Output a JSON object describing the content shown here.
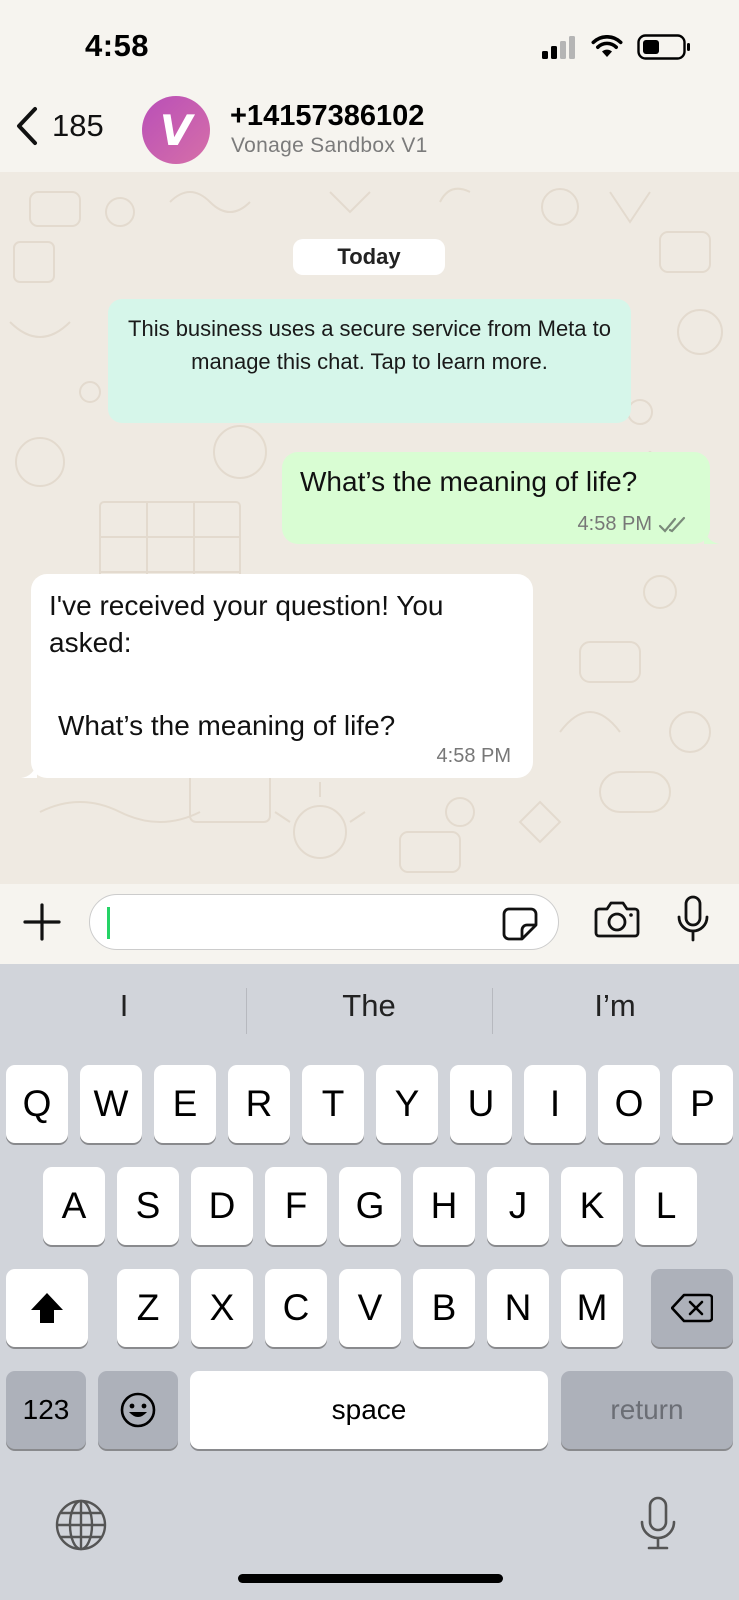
{
  "status_bar": {
    "time": "4:58"
  },
  "header": {
    "back_count": "185",
    "avatar_letter": "V",
    "contact_name": "+14157386102",
    "contact_subtitle": "Vonage Sandbox V1"
  },
  "chat": {
    "date_chip": "Today",
    "system_note": "This business uses a secure service from Meta to manage this chat. Tap to learn more.",
    "messages": [
      {
        "direction": "outgoing",
        "text": "What’s the meaning of life?",
        "time": "4:58 PM",
        "status": "read"
      },
      {
        "direction": "incoming",
        "text": "I've received your question! You asked:",
        "quote": "What’s the meaning of life?",
        "time": "4:58 PM"
      }
    ]
  },
  "composer": {
    "value": ""
  },
  "keyboard": {
    "suggestions": [
      "I",
      "The",
      "I’m"
    ],
    "row1": [
      "Q",
      "W",
      "E",
      "R",
      "T",
      "Y",
      "U",
      "I",
      "O",
      "P"
    ],
    "row2": [
      "A",
      "S",
      "D",
      "F",
      "G",
      "H",
      "J",
      "K",
      "L"
    ],
    "row3": [
      "Z",
      "X",
      "C",
      "V",
      "B",
      "N",
      "M"
    ],
    "numbers_label": "123",
    "space_label": "space",
    "return_label": "return"
  },
  "colors": {
    "outgoing_bubble": "#d9fdd3",
    "incoming_bubble": "#ffffff",
    "system_note": "#d6f6ea",
    "avatar_gradient_start": "#b94fb8",
    "avatar_gradient_end": "#d66fa8",
    "typing_cursor": "#25d366"
  },
  "icons": [
    "back-chevron-icon",
    "signal-icon",
    "wifi-icon",
    "battery-icon",
    "plus-icon",
    "sticker-icon",
    "camera-icon",
    "mic-icon",
    "shift-icon",
    "delete-icon",
    "emoji-icon",
    "globe-icon",
    "dictation-icon",
    "double-check-icon"
  ]
}
